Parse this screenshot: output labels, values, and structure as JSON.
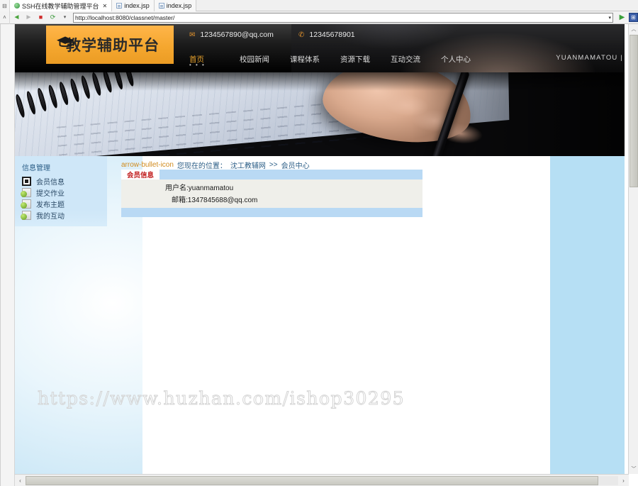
{
  "browser": {
    "tabs": [
      {
        "title": "SSH在线教学辅助管理平台",
        "icon": "globe-icon",
        "active": true,
        "close": "✕"
      },
      {
        "title": "index.jsp",
        "icon": "document-icon",
        "active": false,
        "close": ""
      },
      {
        "title": "index.jsp",
        "icon": "document-icon",
        "active": false,
        "close": ""
      }
    ],
    "toolbar": {
      "back_icon": "◄",
      "forward_icon": "►",
      "stop_icon": "■",
      "reload_icon": "⟳",
      "dropdown_icon": "▾",
      "go_icon": "▶",
      "blue_icon": "⊞",
      "url": "http://localhost:8080/classnet/master/",
      "url_caret": "▾"
    },
    "gutter_top": "⊟",
    "gutter_toolbar": "˄",
    "vscroll": {
      "up": "︿",
      "down": "﹀"
    },
    "hscroll": {
      "left": "‹",
      "right": "›"
    }
  },
  "site": {
    "logo_text": "教学辅助平台",
    "contacts": {
      "email_icon": "✉",
      "email": "1234567890@qq.com",
      "phone_icon": "✆",
      "phone": "12345678901"
    },
    "nav": [
      {
        "label": "首页",
        "active": true,
        "dots": "• • •"
      },
      {
        "label": "校园新闻",
        "active": false,
        "dots": ""
      },
      {
        "label": "课程体系",
        "active": false,
        "dots": ""
      },
      {
        "label": "资源下载",
        "active": false,
        "dots": ""
      },
      {
        "label": "互动交流",
        "active": false,
        "dots": ""
      },
      {
        "label": "个人中心",
        "active": false,
        "dots": ""
      }
    ],
    "user_label": "YUANMAMATOU |"
  },
  "sidebar": {
    "title": "信息管理",
    "items": [
      {
        "label": "会员信息",
        "icon": "monitor-icon",
        "active": true
      },
      {
        "label": "提交作业",
        "icon": "folder-icon",
        "active": false
      },
      {
        "label": "发布主题",
        "icon": "folder-icon",
        "active": false
      },
      {
        "label": "我的互动",
        "icon": "folder-icon",
        "active": false
      }
    ]
  },
  "main": {
    "breadcrumb": {
      "icon": "arrow-bullet-icon",
      "prefix": "您现在的位置：",
      "root": "沈工教辅网",
      "separator": ">>",
      "current": "会员中心"
    },
    "panel_tab": "会员信息",
    "fields": [
      {
        "label": "用户名",
        "value": "yuanmamatou",
        "text": "用户名:yuanmamatou"
      },
      {
        "label": "邮箱",
        "value": "1347845688@qq.com",
        "text": "邮箱:1347845688@qq.com"
      }
    ],
    "watermark": "https://www.huzhan.com/ishop30295"
  },
  "colors": {
    "accent_orange": "#f5a72f",
    "panel_blue": "#b9d9f4",
    "sidebar_blue": "#cfe7f8",
    "tab_red": "#c01a1a",
    "link_blue": "#2a5d86"
  }
}
